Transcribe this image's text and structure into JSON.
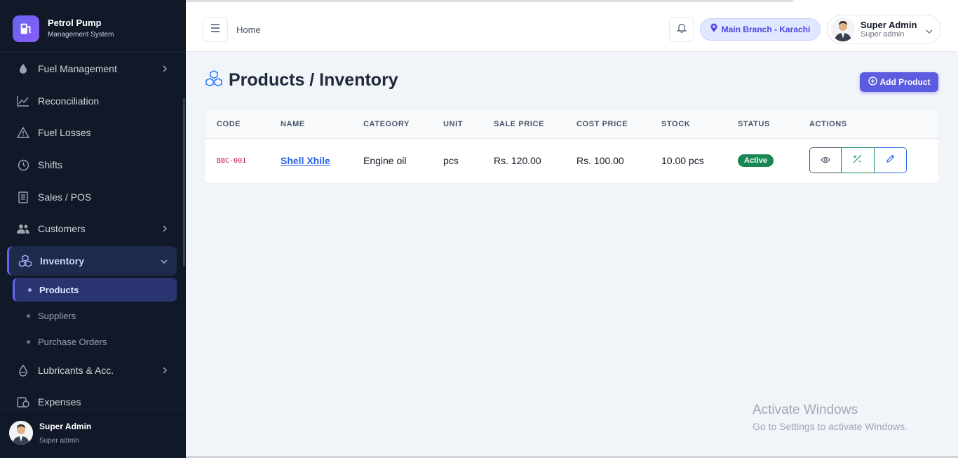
{
  "brand": {
    "title": "Petrol Pump",
    "subtitle": "Management System"
  },
  "sidebar": {
    "items": [
      {
        "label": "Fuel Management",
        "icon": "droplet-icon"
      },
      {
        "label": "Reconciliation",
        "icon": "trend-chart-icon"
      },
      {
        "label": "Fuel Losses",
        "icon": "warning-triangle-icon"
      },
      {
        "label": "Shifts",
        "icon": "clock-icon"
      },
      {
        "label": "Sales / POS",
        "icon": "receipt-icon"
      },
      {
        "label": "Customers",
        "icon": "users-icon"
      },
      {
        "label": "Inventory",
        "icon": "boxes-icon"
      },
      {
        "label": "Lubricants & Acc.",
        "icon": "oil-drop-icon"
      },
      {
        "label": "Expenses",
        "icon": "expense-icon"
      }
    ],
    "inventory_sub": [
      {
        "label": "Products"
      },
      {
        "label": "Suppliers"
      },
      {
        "label": "Purchase Orders"
      }
    ],
    "user": {
      "name": "Super Admin",
      "role": "Super admin"
    }
  },
  "header": {
    "breadcrumb": "Home",
    "branch": "Main Branch - Karachi",
    "user": {
      "name": "Super Admin",
      "role": "Super admin"
    }
  },
  "page": {
    "title": "Products / Inventory",
    "add_button": "Add Product"
  },
  "table": {
    "headers": [
      "CODE",
      "NAME",
      "CATEGORY",
      "UNIT",
      "SALE PRICE",
      "COST PRICE",
      "STOCK",
      "STATUS",
      "ACTIONS"
    ],
    "rows": [
      {
        "code": "BBC-001",
        "name": "Shell Xhile",
        "category": "Engine oil",
        "unit": "pcs",
        "sale_price": "Rs. 120.00",
        "cost_price": "Rs. 100.00",
        "stock": "10.00 pcs",
        "status": "Active"
      }
    ]
  },
  "colors": {
    "sidebar_bg": "#111827",
    "accent": "#5b5ce0",
    "status_active": "#198754",
    "link": "#2563eb"
  },
  "watermark": {
    "line1": "Activate Windows",
    "line2": "Go to Settings to activate Windows."
  }
}
